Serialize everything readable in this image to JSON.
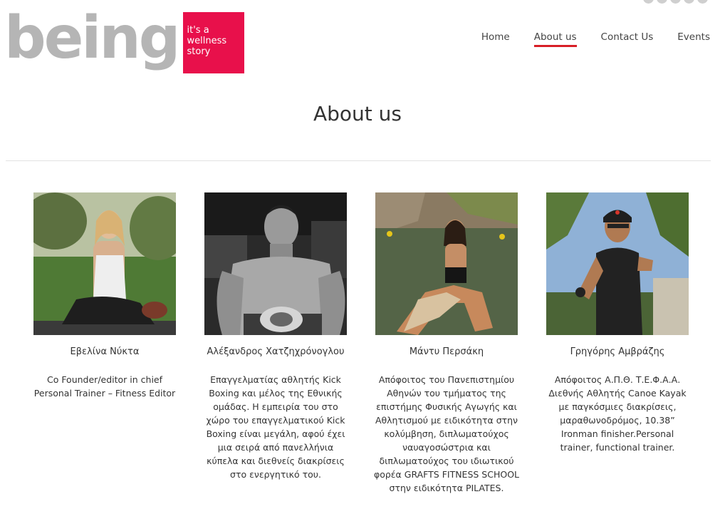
{
  "brand": {
    "word": "being",
    "tagline": [
      "it's a",
      "wellness",
      "story"
    ],
    "colors": {
      "box": "#e8104b",
      "word": "#b5b5b5",
      "accent": "#d81f26"
    }
  },
  "nav": {
    "items": [
      {
        "label": "Home",
        "active": false
      },
      {
        "label": "About us",
        "active": true
      },
      {
        "label": "Contact Us",
        "active": false
      },
      {
        "label": "Events",
        "active": false
      }
    ]
  },
  "page": {
    "title": "About us"
  },
  "team": [
    {
      "name": "Εβελίνα Νύκτα",
      "bio": [
        "Co Founder/editor in chief",
        "Personal Trainer – Fitness Editor"
      ]
    },
    {
      "name": "Αλέξανδρος Χατζηχρόνογλου",
      "bio": [
        "Επαγγελματίας αθλητής Kick",
        "Boxing και μέλος της Εθνικής",
        "ομάδας. Η εμπειρία του στο",
        "χώρο του επαγγελματικού Kick",
        "Boxing είναι μεγάλη, αφού έχει",
        "μια σειρά από πανελλήνια",
        "κύπελα και διεθνείς διακρίσεις",
        "στο ενεργητικό του."
      ]
    },
    {
      "name": "Μάντυ Περσάκη",
      "bio": [
        "Απόφοιτος του Πανεπιστημίου",
        "Αθηνών του τμήματος της",
        "επιστήμης Φυσικής Αγωγής και",
        "Αθλητισμού με ειδικότητα στην",
        "κολύμβηση, διπλωματούχος",
        "ναυαγοσώστρια και",
        "διπλωματούχος του ιδιωτικού",
        "φορέα GRAFTS FITNESS SCHOOL",
        "στην ειδικότητα PILATES."
      ]
    },
    {
      "name": "Γρηγόρης Αμβράζης",
      "bio": [
        "Απόφοιτος Α.Π.Θ. Τ.Ε.Φ.Α.Α.",
        "Διεθνής Αθλητής Canoe Kayak",
        "με παγκόσμιες διακρίσεις,",
        "μαραθωνοδρόμος, 10.38”",
        "Ironman finisher.Personal",
        "trainer, functional trainer."
      ]
    }
  ]
}
